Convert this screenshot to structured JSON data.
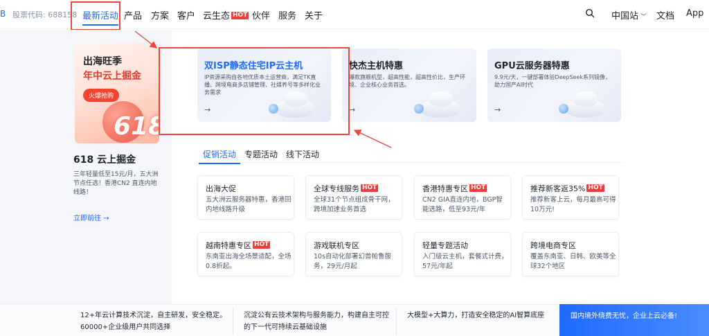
{
  "header": {
    "brand_edge": "B",
    "stock_code": "股票代码: 688158",
    "nav": [
      {
        "label": "最新活动"
      },
      {
        "label": "产品"
      },
      {
        "label": "方案"
      },
      {
        "label": "客户"
      },
      {
        "label": "云生态"
      },
      {
        "label": "伙伴"
      },
      {
        "label": "服务"
      },
      {
        "label": "关于"
      }
    ],
    "hot_tag": "HOT",
    "region": "中国站",
    "docs": "文档",
    "app": "App"
  },
  "promo": {
    "title_line1": "出海旺季",
    "title_line2": "年中云上掘金",
    "pill": "火爆抢购",
    "big_number": "618",
    "heading": "618 云上掘金",
    "description": "三年轻量低至15元/月，五大洲节点任选！香港CN2 直连内地线路！",
    "link": "立即前往 →"
  },
  "features": [
    {
      "title": "双ISP静态住宅IP云主机",
      "desc": "IP资源采购自各地优质本土运营商，满足TK直播、跨境电商多店铺管理、社媒养号等多样化业务需求",
      "arrow": "→"
    },
    {
      "title": "快杰主机特惠",
      "desc": "爆款旗舰机型，超高性能，超高性价比，生产环境、企业核心业务首选。",
      "arrow": "→"
    },
    {
      "title": "GPU云服务器特惠",
      "desc": "9.9元/天，一键部署体验DeepSeek系列镜像，助力国产AI时代",
      "arrow": "→"
    }
  ],
  "tabs": [
    {
      "label": "促销活动"
    },
    {
      "label": "专题活动"
    },
    {
      "label": "线下活动"
    }
  ],
  "cards": [
    {
      "title": "出海大促",
      "hot": "",
      "desc": "五大洲云服务器特惠，香港回内地线路升级"
    },
    {
      "title": "全球专线服务",
      "hot": "HOT",
      "desc": "全球31个节点组成骨干网，跨境加速业务首选"
    },
    {
      "title": "香港特惠专区",
      "hot": "HOT",
      "desc": "CN2 GIA直连内地，BGP智能选路，低至93元/年"
    },
    {
      "title": "推荐新客返35%",
      "hot": "HOT",
      "desc": "推荐新客上云，每月最高可得10万元!"
    },
    {
      "title": "越南特惠专区",
      "hot": "HOT",
      "desc": "东南亚出海全场景适配，全场0.8折起。"
    },
    {
      "title": "游戏联机专区",
      "hot": "",
      "desc": "10s自动化部署幻兽帕鲁服务，29元/月起"
    },
    {
      "title": "轻量专题活动",
      "hot": "",
      "desc": "入门级云主机，套餐式计费，57元/年起"
    },
    {
      "title": "跨境电商专区",
      "hot": "",
      "desc": "覆盖东南亚、日韩、欧美等全球32个地区"
    }
  ],
  "bottom": {
    "col1_line1": "12+年云计算技术沉淀，自主研发，安全稳定。",
    "col1_line2": "60000+企业级用户共同选择",
    "col2_line1": "沉淀公有云技术架构与服务能力，构建自主可控",
    "col2_line2": "的下一代可持续云基础设施",
    "col3_line1": "大模型+大算力，打造安全稳定的AI智算底座",
    "banner": "国内境外绕费无忧，企业上云必备!"
  },
  "colors": {
    "accent": "#1f6bff",
    "hot": "#ee3b3b",
    "annotation": "#e9473c"
  }
}
